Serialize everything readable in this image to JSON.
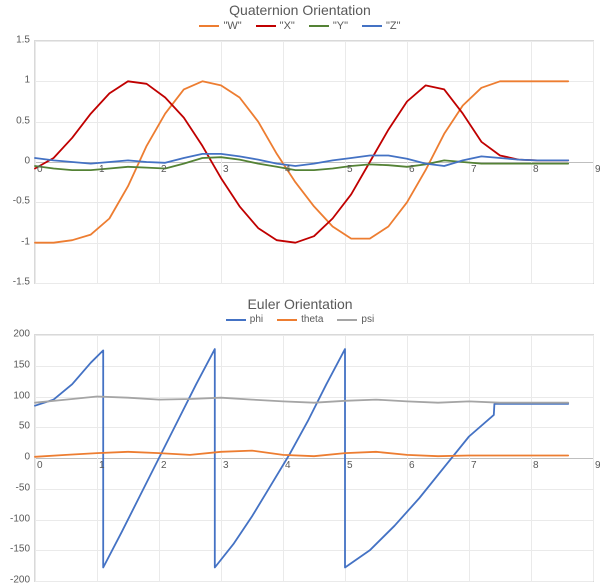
{
  "chart_data": [
    {
      "type": "line",
      "title": "Quaternion Orientation",
      "xlabel": "",
      "ylabel": "",
      "xlim": [
        0,
        9
      ],
      "ylim": [
        -1.5,
        1.5
      ],
      "y_ticks": [
        -1.5,
        -1,
        -0.5,
        0,
        0.5,
        1,
        1.5
      ],
      "x_ticks": [
        0,
        1,
        2,
        3,
        4,
        5,
        6,
        7,
        8,
        9
      ],
      "colors": {
        "W": "#ed7d31",
        "X": "#c00000",
        "Y": "#548235",
        "Z": "#4472c4"
      },
      "series": [
        {
          "name": "\"W\"",
          "color": "#ed7d31",
          "x": [
            0,
            0.3,
            0.6,
            0.9,
            1.2,
            1.5,
            1.8,
            2.1,
            2.4,
            2.7,
            3.0,
            3.3,
            3.6,
            3.9,
            4.2,
            4.5,
            4.8,
            5.1,
            5.4,
            5.7,
            6.0,
            6.3,
            6.6,
            6.9,
            7.2,
            7.5,
            7.8,
            8.1,
            8.4,
            8.6
          ],
          "y": [
            -1.0,
            -1.0,
            -0.97,
            -0.9,
            -0.7,
            -0.3,
            0.2,
            0.6,
            0.9,
            1.0,
            0.95,
            0.8,
            0.5,
            0.1,
            -0.25,
            -0.55,
            -0.8,
            -0.95,
            -0.95,
            -0.8,
            -0.5,
            -0.1,
            0.35,
            0.7,
            0.92,
            1.0,
            1.0,
            1.0,
            1.0,
            1.0
          ]
        },
        {
          "name": "\"X\"",
          "color": "#c00000",
          "x": [
            0,
            0.3,
            0.6,
            0.9,
            1.2,
            1.5,
            1.8,
            2.1,
            2.4,
            2.7,
            3.0,
            3.3,
            3.6,
            3.9,
            4.2,
            4.5,
            4.8,
            5.1,
            5.4,
            5.7,
            6.0,
            6.3,
            6.6,
            6.9,
            7.2,
            7.5,
            7.8,
            8.1,
            8.4,
            8.6
          ],
          "y": [
            -0.08,
            0.05,
            0.3,
            0.6,
            0.85,
            1.0,
            0.97,
            0.8,
            0.55,
            0.2,
            -0.2,
            -0.55,
            -0.82,
            -0.97,
            -1.0,
            -0.92,
            -0.7,
            -0.4,
            0.0,
            0.4,
            0.75,
            0.95,
            0.9,
            0.6,
            0.25,
            0.08,
            0.03,
            0.02,
            0.02,
            0.02
          ]
        },
        {
          "name": "\"Y\"",
          "color": "#548235",
          "x": [
            0,
            0.3,
            0.6,
            0.9,
            1.2,
            1.5,
            1.8,
            2.1,
            2.4,
            2.7,
            3.0,
            3.3,
            3.6,
            3.9,
            4.2,
            4.5,
            4.8,
            5.1,
            5.4,
            5.7,
            6.0,
            6.3,
            6.6,
            6.9,
            7.2,
            7.5,
            7.8,
            8.1,
            8.4,
            8.6
          ],
          "y": [
            -0.05,
            -0.08,
            -0.1,
            -0.1,
            -0.08,
            -0.06,
            -0.07,
            -0.08,
            -0.02,
            0.05,
            0.06,
            0.03,
            -0.02,
            -0.06,
            -0.1,
            -0.1,
            -0.08,
            -0.05,
            -0.03,
            -0.04,
            -0.06,
            -0.03,
            0.02,
            0.0,
            -0.02,
            -0.02,
            -0.02,
            -0.02,
            -0.02,
            -0.02
          ]
        },
        {
          "name": "\"Z\"",
          "color": "#4472c4",
          "x": [
            0,
            0.3,
            0.6,
            0.9,
            1.2,
            1.5,
            1.8,
            2.1,
            2.4,
            2.7,
            3.0,
            3.3,
            3.6,
            3.9,
            4.2,
            4.5,
            4.8,
            5.1,
            5.4,
            5.7,
            6.0,
            6.3,
            6.6,
            6.9,
            7.2,
            7.5,
            7.8,
            8.1,
            8.4,
            8.6
          ],
          "y": [
            0.05,
            0.02,
            0.0,
            -0.02,
            0.0,
            0.02,
            0.0,
            -0.01,
            0.05,
            0.1,
            0.1,
            0.07,
            0.03,
            -0.02,
            -0.05,
            -0.02,
            0.02,
            0.05,
            0.08,
            0.08,
            0.04,
            -0.02,
            -0.05,
            0.02,
            0.07,
            0.05,
            0.03,
            0.02,
            0.02,
            0.02
          ]
        }
      ]
    },
    {
      "type": "line",
      "title": "Euler Orientation",
      "xlabel": "",
      "ylabel": "",
      "xlim": [
        0,
        9
      ],
      "ylim": [
        -200,
        200
      ],
      "y_ticks": [
        -200,
        -150,
        -100,
        -50,
        0,
        50,
        100,
        150,
        200
      ],
      "x_ticks": [
        0,
        1,
        2,
        3,
        4,
        5,
        6,
        7,
        8,
        9
      ],
      "colors": {
        "phi": "#4472c4",
        "theta": "#ed7d31",
        "psi": "#a5a5a5"
      },
      "series": [
        {
          "name": "phi",
          "color": "#4472c4",
          "x": [
            0,
            0.3,
            0.6,
            0.9,
            1.1,
            1.1,
            1.4,
            1.7,
            2.0,
            2.3,
            2.6,
            2.9,
            2.9,
            3.2,
            3.5,
            3.8,
            4.1,
            4.4,
            4.7,
            5.0,
            5.0,
            5.4,
            5.8,
            6.2,
            6.6,
            7.0,
            7.4,
            7.41,
            7.8,
            8.1,
            8.4,
            8.6
          ],
          "y": [
            85,
            95,
            120,
            155,
            175,
            -178,
            -120,
            -60,
            0,
            60,
            120,
            177,
            -178,
            -140,
            -95,
            -45,
            5,
            60,
            120,
            177,
            -178,
            -150,
            -110,
            -65,
            -15,
            35,
            70,
            88,
            88,
            88,
            88,
            88
          ]
        },
        {
          "name": "theta",
          "color": "#ed7d31",
          "x": [
            0,
            0.5,
            1.0,
            1.5,
            2.0,
            2.5,
            3.0,
            3.5,
            4.0,
            4.5,
            5.0,
            5.5,
            6.0,
            6.5,
            7.0,
            7.5,
            8.0,
            8.6
          ],
          "y": [
            2,
            5,
            8,
            10,
            8,
            5,
            10,
            12,
            5,
            3,
            8,
            10,
            5,
            3,
            4,
            4,
            4,
            4
          ]
        },
        {
          "name": "psi",
          "color": "#a5a5a5",
          "x": [
            0,
            0.5,
            1.0,
            1.5,
            2.0,
            2.5,
            3.0,
            3.5,
            4.0,
            4.5,
            5.0,
            5.5,
            6.0,
            6.5,
            7.0,
            7.5,
            8.0,
            8.6
          ],
          "y": [
            90,
            95,
            100,
            98,
            95,
            96,
            98,
            95,
            92,
            90,
            93,
            95,
            92,
            90,
            92,
            90,
            90,
            90
          ]
        }
      ]
    }
  ]
}
